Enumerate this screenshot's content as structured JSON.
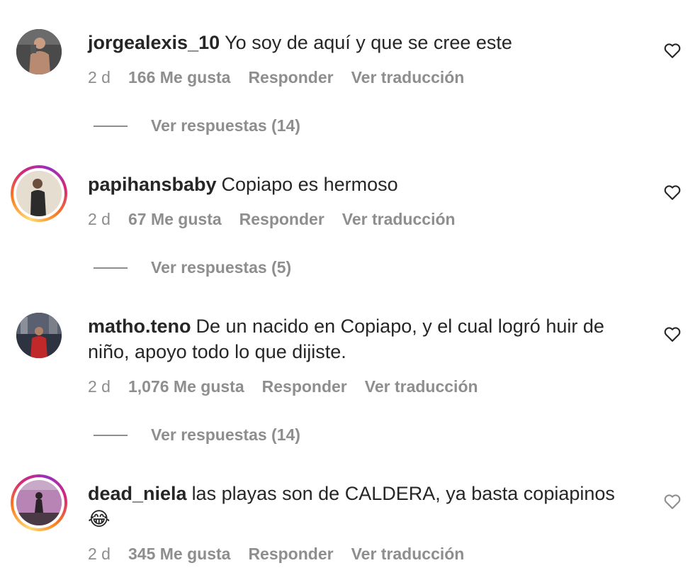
{
  "comments": [
    {
      "username": "jorgealexis_10",
      "text": "Yo soy de aquí y que se cree este",
      "time": "2 d",
      "likes": "166 Me gusta",
      "reply": "Responder",
      "translate": "Ver traducción",
      "view_replies": "Ver respuestas (14)",
      "story_ring": false
    },
    {
      "username": "papihansbaby",
      "text": "Copiapo es hermoso",
      "time": "2 d",
      "likes": "67 Me gusta",
      "reply": "Responder",
      "translate": "Ver traducción",
      "view_replies": "Ver respuestas (5)",
      "story_ring": true
    },
    {
      "username": "matho.teno",
      "text": "De un nacido en Copiapo, y el cual logró huir de niño, apoyo todo lo que dijiste.",
      "time": "2 d",
      "likes": "1,076 Me gusta",
      "reply": "Responder",
      "translate": "Ver traducción",
      "view_replies": "Ver respuestas (14)",
      "story_ring": false
    },
    {
      "username": "dead_niela",
      "text": "las playas son de CALDERA, ya basta copiapinos",
      "emoji": "😂",
      "time": "2 d",
      "likes": "345 Me gusta",
      "reply": "Responder",
      "translate": "Ver traducción",
      "story_ring": true
    }
  ],
  "colors": {
    "text": "#262626",
    "muted": "#8e8e8e",
    "ring": [
      "#feda75",
      "#fa7e1e",
      "#d62976",
      "#962fbf"
    ]
  },
  "icons": {
    "like": "heart-outline-icon"
  }
}
